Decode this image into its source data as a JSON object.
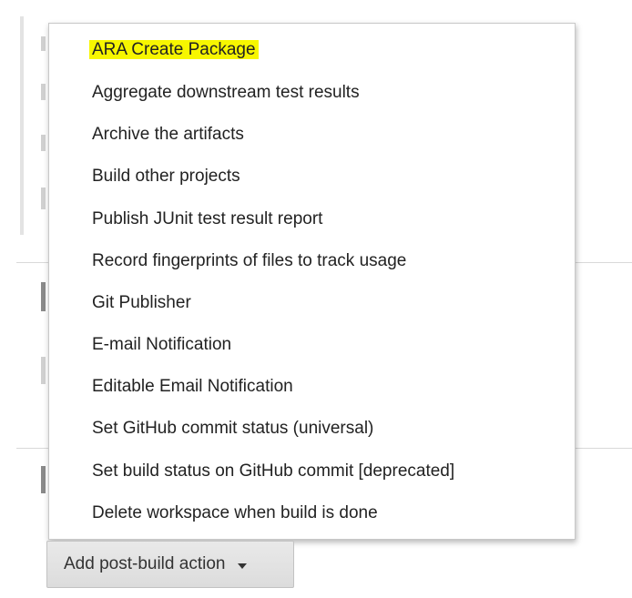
{
  "menu": {
    "items": [
      {
        "label": "ARA Create Package",
        "highlighted": true
      },
      {
        "label": "Aggregate downstream test results",
        "highlighted": false
      },
      {
        "label": "Archive the artifacts",
        "highlighted": false
      },
      {
        "label": "Build other projects",
        "highlighted": false
      },
      {
        "label": "Publish JUnit test result report",
        "highlighted": false
      },
      {
        "label": "Record fingerprints of files to track usage",
        "highlighted": false
      },
      {
        "label": "Git Publisher",
        "highlighted": false
      },
      {
        "label": "E-mail Notification",
        "highlighted": false
      },
      {
        "label": "Editable Email Notification",
        "highlighted": false
      },
      {
        "label": "Set GitHub commit status (universal)",
        "highlighted": false
      },
      {
        "label": "Set build status on GitHub commit [deprecated]",
        "highlighted": false
      },
      {
        "label": "Delete workspace when build is done",
        "highlighted": false
      }
    ]
  },
  "add_button": {
    "label": "Add post-build action",
    "icon": "caret-down-icon"
  },
  "colors": {
    "highlight": "#f7f600",
    "text": "#222222",
    "button_bg": "#e2e2e2"
  }
}
